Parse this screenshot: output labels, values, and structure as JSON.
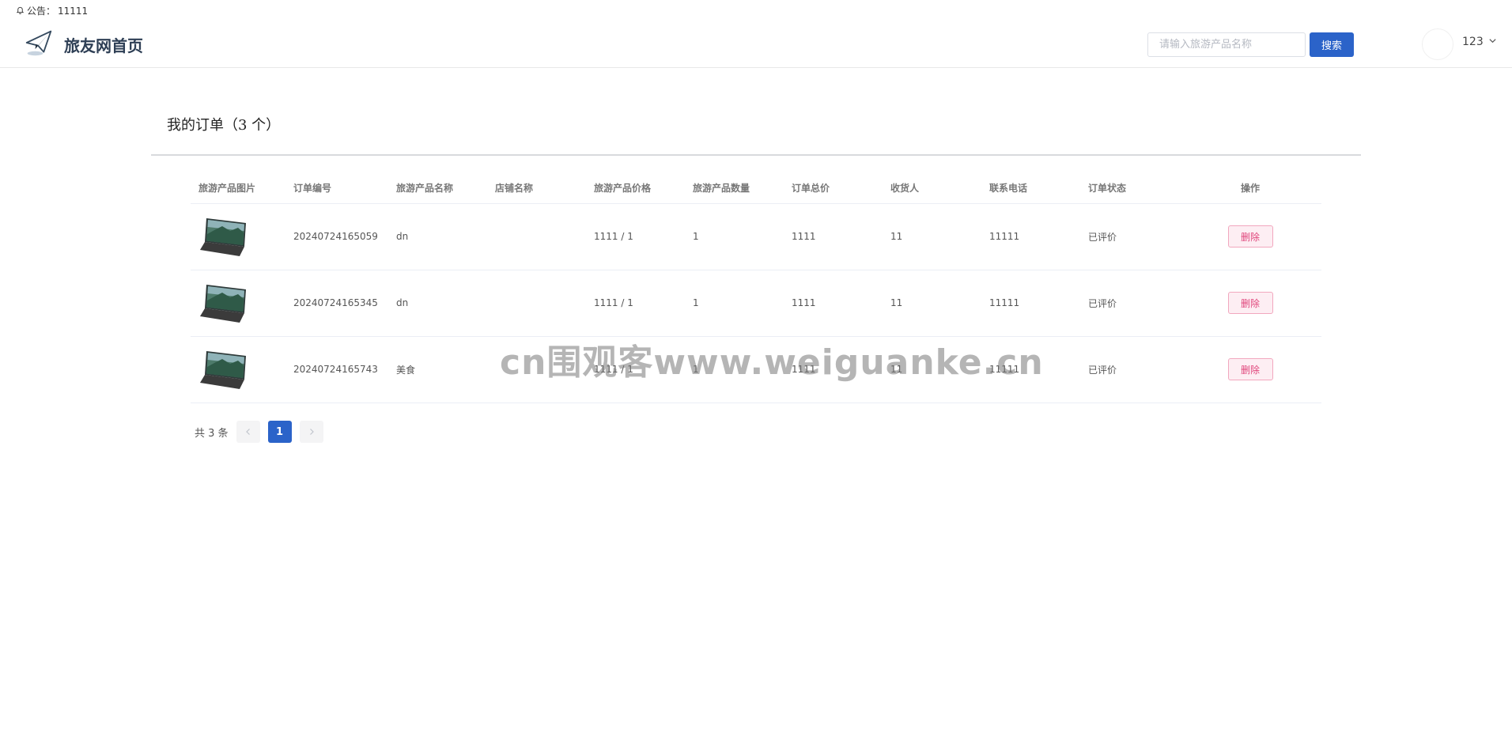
{
  "notice": {
    "label": "公告：",
    "text": "11111"
  },
  "header": {
    "site_title": "旅友网首页",
    "search_placeholder": "请输入旅游产品名称",
    "search_button": "搜索",
    "username": "123"
  },
  "main": {
    "title": "我的订单（3 个）",
    "columns": [
      "旅游产品图片",
      "订单编号",
      "旅游产品名称",
      "店铺名称",
      "旅游产品价格",
      "旅游产品数量",
      "订单总价",
      "收货人",
      "联系电话",
      "订单状态",
      "操作"
    ],
    "rows": [
      {
        "order_no": "20240724165059",
        "product": "dn",
        "shop": "",
        "price": "1111 / 1",
        "quantity": "1",
        "total": "1111",
        "receiver": "11",
        "phone": "11111",
        "status": "已评价",
        "action": "删除"
      },
      {
        "order_no": "20240724165345",
        "product": "dn",
        "shop": "",
        "price": "1111 / 1",
        "quantity": "1",
        "total": "1111",
        "receiver": "11",
        "phone": "11111",
        "status": "已评价",
        "action": "删除"
      },
      {
        "order_no": "20240724165743",
        "product": "美食",
        "shop": "",
        "price": "1111 / 1",
        "quantity": "1",
        "total": "1111",
        "receiver": "11",
        "phone": "11111",
        "status": "已评价",
        "action": "删除"
      }
    ],
    "pagination": {
      "total_text": "共 3 条",
      "current_page": "1"
    }
  },
  "watermark": "cn围观客www.weiguanke.cn",
  "colors": {
    "primary": "#2b63c9",
    "delete_text": "#e0457b",
    "product_link": "#6a2a8a"
  }
}
